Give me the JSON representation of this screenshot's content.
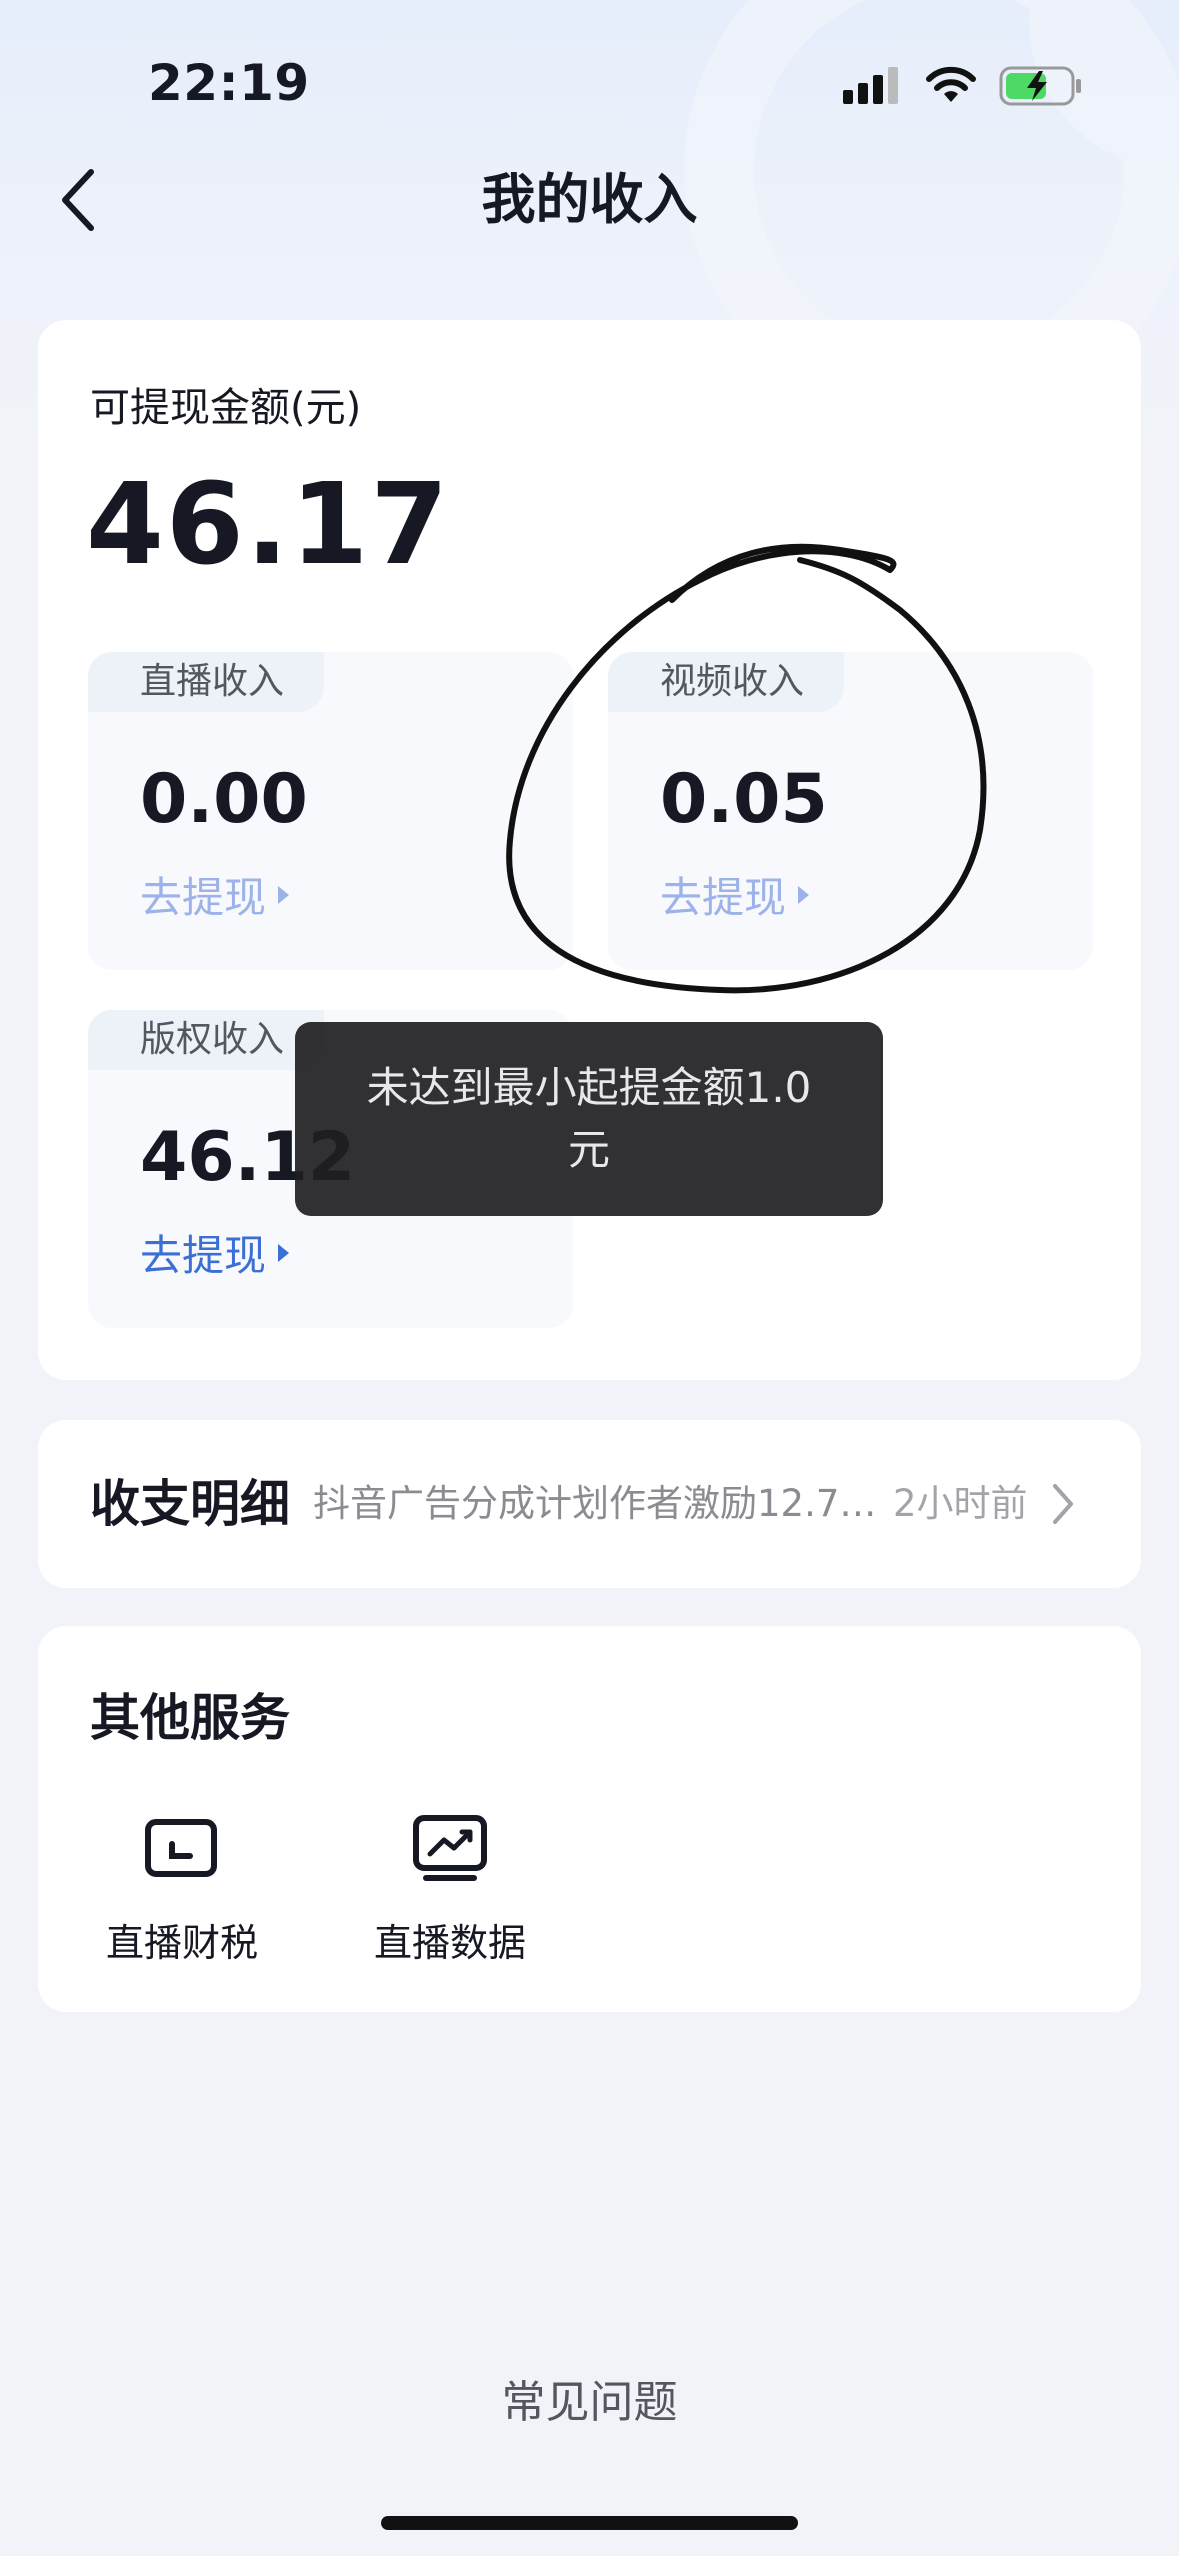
{
  "status_bar": {
    "time": "22:19"
  },
  "header": {
    "title": "我的收入"
  },
  "balance": {
    "label": "可提现金额(元)",
    "amount": "46.17"
  },
  "income_cards": [
    {
      "label": "直播收入",
      "value": "0.00",
      "action": "去提现"
    },
    {
      "label": "视频收入",
      "value": "0.05",
      "action": "去提现"
    },
    {
      "label": "版权收入",
      "value": "46.12",
      "action": "去提现"
    }
  ],
  "toast": {
    "message": "未达到最小起提金额1.0元"
  },
  "ledger": {
    "title": "收支明细",
    "latest": "抖音广告分成计划作者激励12.7…",
    "time": "2小时前"
  },
  "services": {
    "title": "其他服务",
    "items": [
      {
        "label": "直播财税",
        "icon": "monitor-icon"
      },
      {
        "label": "直播数据",
        "icon": "chart-monitor-icon"
      }
    ]
  },
  "footer": {
    "faq": "常见问题"
  },
  "colors": {
    "link_inactive": "#9CB2E8",
    "link_active": "#3C6FD6",
    "background": "#F1F3F8"
  }
}
